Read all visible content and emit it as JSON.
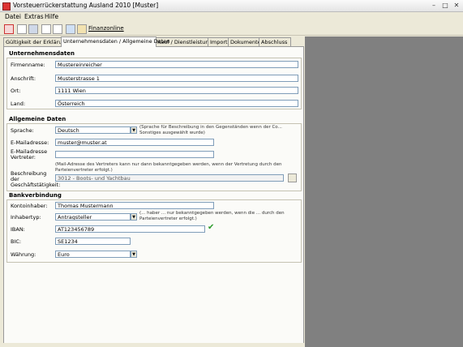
{
  "window": {
    "title": "Vorsteuerrückerstattung Ausland 2010 [Muster]"
  },
  "menu": [
    "Datei",
    "Extras",
    "Hilfe"
  ],
  "toolbar": {
    "finanzonline_label": "Finanzonline"
  },
  "tabs": [
    "Gültigkeit der Erklärung",
    "Unternehmensdaten / Allgemeine Daten",
    "Kauf / Dienstleistung",
    "Import",
    "Dokumente",
    "Abschluss"
  ],
  "unternehmensdaten": {
    "title": "Unternehmensdaten",
    "firmenname_label": "Firmenname:",
    "firmenname": "Mustereinreicher",
    "anschrift_label": "Anschrift:",
    "anschrift": "Musterstrasse 1",
    "ort_label": "Ort:",
    "ort": "1111 Wien",
    "land_label": "Land:",
    "land": "Österreich"
  },
  "allgemein": {
    "title": "Allgemeine Daten",
    "sprache_label": "Sprache:",
    "sprache": "Deutsch",
    "sprache_note": "(Sprache für Beschreibung in den Gegenständen wenn der Co... Sonstiges ausgewählt wurde)",
    "email_label": "E-Mailadresse:",
    "email": "muster@muster.at",
    "email_vertreter_label": "E-Mailadresse Vertreter:",
    "email_vertreter": "",
    "vertreter_note": "(Mail-Adresse des Vertreters kann nur dann bekanntgegeben werden, wenn der Vertretung durch den Parteienvertreter erfolgt.)",
    "beschreibung_label": "Beschreibung der Geschäftstätigkeit:",
    "beschreibung": "3012 - Boots- und Yachtbau"
  },
  "bank": {
    "title": "Bankverbindung",
    "kontoinhaber_label": "Kontoinhaber:",
    "kontoinhaber": "Thomas Mustermann",
    "inhabertyp_label": "Inhabertyp:",
    "inhabertyp": "Antragsteller",
    "inhaber_note": "(... haber ... nur bekanntgegeben werden, wenn die ... durch den Parteienvertreter erfolgt.)",
    "iban_label": "IBAN:",
    "iban": "AT123456789",
    "bic_label": "BIC:",
    "bic": "SE1234",
    "waehrung_label": "Währung:",
    "waehrung": "Euro"
  }
}
